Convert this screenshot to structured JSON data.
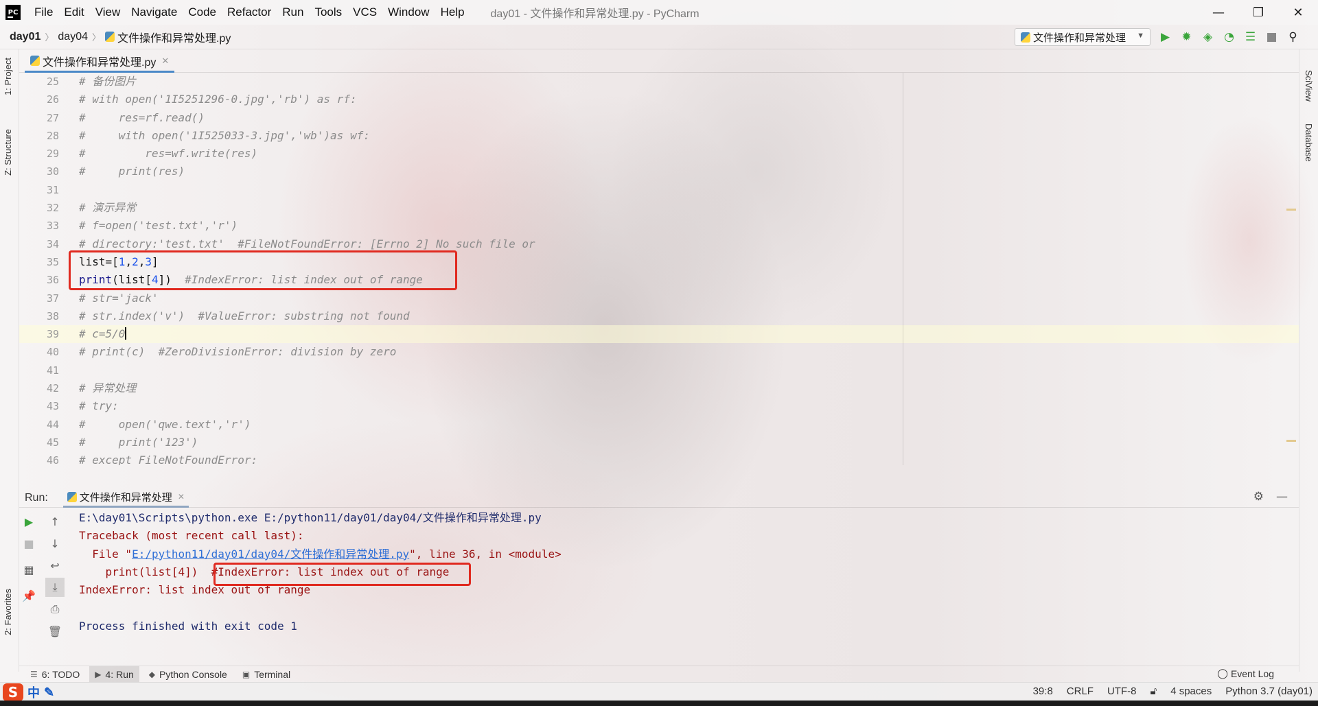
{
  "window": {
    "title": "day01 - 文件操作和异常处理.py - PyCharm",
    "logo": "PC",
    "controls": [
      "—",
      "❐",
      "✕"
    ]
  },
  "menu": [
    "File",
    "Edit",
    "View",
    "Navigate",
    "Code",
    "Refactor",
    "Run",
    "Tools",
    "VCS",
    "Window",
    "Help"
  ],
  "breadcrumb": [
    "day01",
    "day04",
    "文件操作和异常处理.py"
  ],
  "run_config": "文件操作和异常处理",
  "toolbar_icons": [
    "run-icon",
    "debug-icon",
    "coverage-icon",
    "profile-icon",
    "concurrency-icon",
    "stop-icon",
    "search-icon"
  ],
  "left_tabs": [
    "1: Project",
    "Z: Structure",
    "2: Favorites"
  ],
  "right_tabs": [
    "SciView",
    "Database"
  ],
  "editor": {
    "tab": "文件操作和异常处理.py",
    "lines": [
      {
        "n": "25",
        "t": "# 备份图片"
      },
      {
        "n": "26",
        "t": "# with open('1I5251296-0.jpg','rb') as rf:"
      },
      {
        "n": "27",
        "t": "#     res=rf.read()"
      },
      {
        "n": "28",
        "t": "#     with open('1I525033-3.jpg','wb')as wf:"
      },
      {
        "n": "29",
        "t": "#         res=wf.write(res)"
      },
      {
        "n": "30",
        "t": "#     print(res)"
      },
      {
        "n": "31",
        "t": ""
      },
      {
        "n": "32",
        "t": "# 演示异常"
      },
      {
        "n": "33",
        "t": "# f=open('test.txt','r')"
      },
      {
        "n": "34",
        "t": "# directory:'test.txt'  #FileNotFoundError: [Errno 2] No such file or"
      },
      {
        "n": "35",
        "t": "list=[1,2,3]"
      },
      {
        "n": "36",
        "t": "print(list[4])  #IndexError: list index out of range"
      },
      {
        "n": "37",
        "t": "# str='jack'"
      },
      {
        "n": "38",
        "t": "# str.index('v')  #ValueError: substring not found"
      },
      {
        "n": "39",
        "t": "# c=5/0"
      },
      {
        "n": "40",
        "t": "# print(c)  #ZeroDivisionError: division by zero"
      },
      {
        "n": "41",
        "t": ""
      },
      {
        "n": "42",
        "t": "# 异常处理"
      },
      {
        "n": "43",
        "t": "# try:"
      },
      {
        "n": "44",
        "t": "#     open('qwe.text','r')"
      },
      {
        "n": "45",
        "t": "#     print('123')"
      },
      {
        "n": "46",
        "t": "# except FileNotFoundError:"
      }
    ],
    "code35": {
      "a": "list=[",
      "n1": "1",
      "c1": ",",
      "n2": "2",
      "c2": ",",
      "n3": "3",
      "b": "]"
    },
    "code36": {
      "a": "print",
      "b": "(list[",
      "n": "4",
      "c": "])  ",
      "comment": "#IndexError: list index out of range"
    },
    "code39": "# c=5/0"
  },
  "run": {
    "label": "Run:",
    "tab": "文件操作和异常处理",
    "cmd": "E:\\day01\\Scripts\\python.exe E:/python11/day01/day04/文件操作和异常处理.py",
    "traceback": "Traceback (most recent call last):",
    "file_prefix": "  File \"",
    "file_link": "E:/python11/day01/day04/文件操作和异常处理.py",
    "file_suffix": "\", line 36, in <module>",
    "code_line": "    print(list[4])  ",
    "code_comment": "#IndexError: list index out of range",
    "error": "IndexError: list index out of range",
    "blank": "",
    "exit": "Process finished with exit code 1"
  },
  "bottom_tools": [
    "6: TODO",
    "4: Run",
    "Python Console",
    "Terminal"
  ],
  "event_log": "Event Log",
  "status": {
    "ime_logo": "S",
    "ime_lang": "中",
    "position": "39:8",
    "line_sep": "CRLF",
    "encoding": "UTF-8",
    "indent": "4 spaces",
    "interpreter": "Python 3.7 (day01)"
  },
  "colors": {
    "highlight": "#e0291f",
    "accent": "#4a88c7",
    "run_green": "#3ba53b"
  }
}
